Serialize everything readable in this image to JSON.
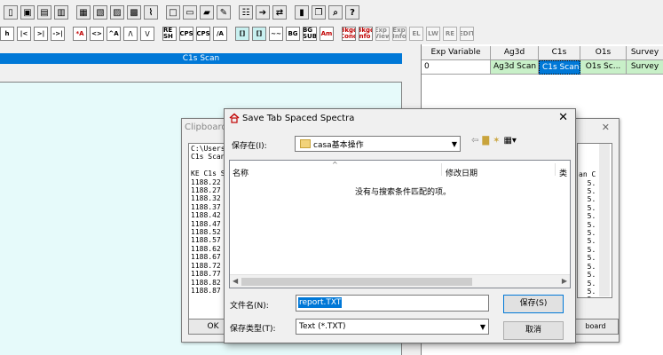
{
  "toolbar_row1": {
    "icons": [
      "new-icon",
      "open-icon",
      "open-multi-icon",
      "save-icon",
      "save-as-icon",
      "save-all-icon",
      "print-icon",
      "print-preview-icon",
      "spectrum-icon",
      "window-icon",
      "tile-icon",
      "layout-icon",
      "pencil-icon",
      "table-icon",
      "arrow-icon",
      "toggle-icon",
      "clipboard-icon",
      "copy-icon",
      "find-icon",
      "help-icon"
    ]
  },
  "toolbar_row2": {
    "buttons": [
      {
        "label": "h",
        "style": "plain"
      },
      {
        "label": "|<",
        "style": "plain"
      },
      {
        "label": ">|",
        "style": "plain"
      },
      {
        "label": "->|",
        "style": "plain"
      },
      {
        "label": "*A",
        "style": "red"
      },
      {
        "label": "<>",
        "style": "plain"
      },
      {
        "label": "^A",
        "style": "plain"
      },
      {
        "label": "/\\",
        "style": "plain"
      },
      {
        "label": "\\/",
        "style": "plain"
      },
      {
        "label": "RE SH",
        "style": "plain"
      },
      {
        "label": "CPS",
        "style": "plain"
      },
      {
        "label": "CPS",
        "style": "plain"
      },
      {
        "label": "/A",
        "style": "plain"
      },
      {
        "label": "[]",
        "style": "teal"
      },
      {
        "label": "[]",
        "style": "teal"
      },
      {
        "label": "~~",
        "style": "plain"
      },
      {
        "label": "BG",
        "style": "plain"
      },
      {
        "label": "BG SUB",
        "style": "plain"
      },
      {
        "label": "Am",
        "style": "red"
      },
      {
        "label": "Bkgd Conc",
        "style": "red"
      },
      {
        "label": "Bkgd Info",
        "style": "red"
      },
      {
        "label": "Exp View",
        "style": "gray"
      },
      {
        "label": "Exp Info",
        "style": "gray"
      },
      {
        "label": "EL",
        "style": "gray"
      },
      {
        "label": "LW",
        "style": "gray"
      },
      {
        "label": "RE",
        "style": "gray"
      },
      {
        "label": "EDIT",
        "style": "gray"
      }
    ]
  },
  "spectrum": {
    "title": "C1s Scan"
  },
  "grid": {
    "headers": [
      "Exp Variable",
      "Ag3d",
      "C1s",
      "O1s",
      "Survey"
    ],
    "row": [
      "0",
      "Ag3d Scan",
      "C1s Scan",
      "O1s Sc...",
      "Survey"
    ]
  },
  "clipboard": {
    "title": "Clipboard",
    "left_text": "C:\\Users\nC1s Scan\n\nKE C1s S\n1188.22\n1188.27\n1188.32\n1188.37\n1188.42\n1188.47\n1188.52\n1188.57\n1188.62\n1188.67\n1188.72\n1188.77\n1188.82\n1188.87",
    "right_text": "\n\n\nan C\n  5.\n  5.\n  5.\n  5.\n  5.\n  5.\n  5.\n  5.\n  5.\n  5.\n  5.\n  5.\n  5.\n  5.\n  5.",
    "ok_label": "OK",
    "right_button_label": "board"
  },
  "dialog": {
    "title": "Save Tab Spaced Spectra",
    "save_in_label": "保存在(I):",
    "location": "casa基本操作",
    "columns": {
      "name": "名称",
      "date": "修改日期",
      "type": "类"
    },
    "empty_message": "没有与搜索条件匹配的项。",
    "filename_label": "文件名(N):",
    "filename_value": "report.TXT",
    "filetype_label": "保存类型(T):",
    "filetype_value": "Text (*.TXT)",
    "save_button": "保存(S)",
    "cancel_button": "取消"
  }
}
